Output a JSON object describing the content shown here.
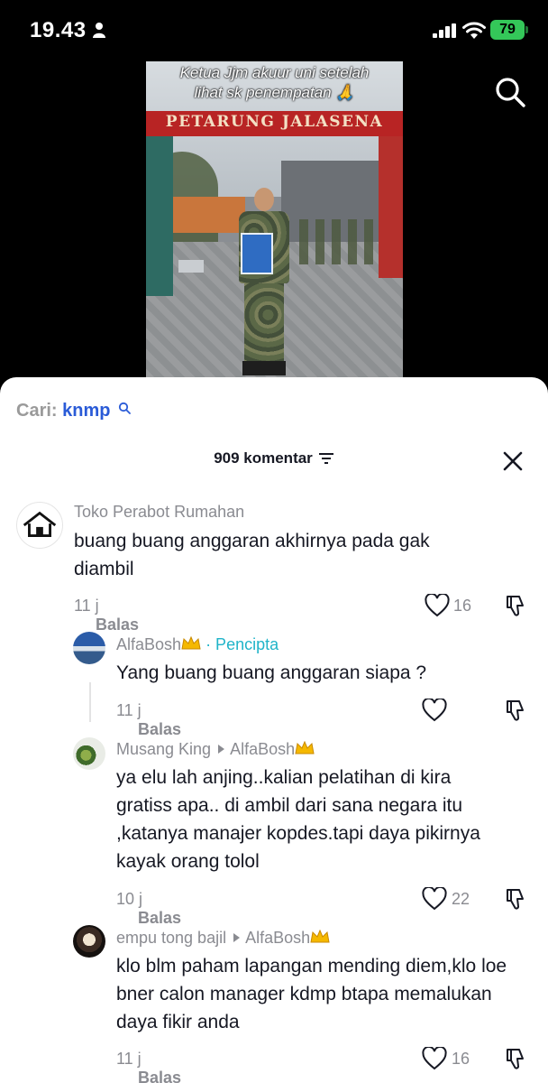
{
  "status_bar": {
    "time": "19.43",
    "battery": "79"
  },
  "video": {
    "caption_line1": "Ketua Jjm akuur uni setelah",
    "caption_line2": "lihat sk penempatan 🙏",
    "gate_text": "PETARUNG JALASENA"
  },
  "search_bar": {
    "prefix": "Cari:",
    "term": "knmp"
  },
  "comments_header": {
    "count_label": "909 komentar"
  },
  "comments": [
    {
      "username": "Toko Perabot Rumahan",
      "text": "buang buang anggaran akhirnya pada gak diambil",
      "age": "11 j",
      "reply_label": "Balas",
      "likes": "16"
    },
    {
      "username": "AlfaBosh",
      "badge": "· Pencipta",
      "text": "Yang buang buang anggaran siapa ?",
      "age": "11 j",
      "reply_label": "Balas",
      "likes": ""
    },
    {
      "username": "Musang King",
      "reply_to": "AlfaBosh",
      "text": "ya elu lah anjing..kalian pelatihan di kira gratiss apa.. di ambil dari sana negara itu ,katanya manajer kopdes.tapi daya pikirnya kayak orang tolol",
      "age": "10 j",
      "reply_label": "Balas",
      "likes": "22"
    },
    {
      "username": "empu tong bajil",
      "reply_to": "AlfaBosh",
      "text": "klo blm paham lapangan mending diem,klo loe bner calon manager kdmp btapa memalukan daya fikir anda",
      "age": "11 j",
      "reply_label": "Balas",
      "likes": "16"
    }
  ]
}
